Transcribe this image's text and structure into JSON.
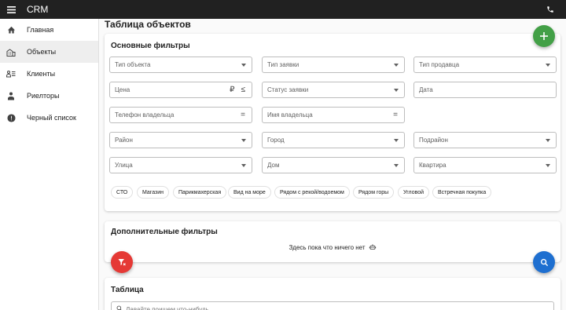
{
  "app": {
    "title": "CRM"
  },
  "sidebar": {
    "items": [
      {
        "label": "Главная",
        "icon": "home-icon"
      },
      {
        "label": "Объекты",
        "icon": "building-icon"
      },
      {
        "label": "Клиенты",
        "icon": "contacts-icon"
      },
      {
        "label": "Риелторы",
        "icon": "person-icon"
      },
      {
        "label": "Черный список",
        "icon": "alert-icon"
      }
    ],
    "active": "Объекты"
  },
  "page": {
    "title": "Таблица объектов"
  },
  "main_filters": {
    "title": "Основные фильтры",
    "fields": {
      "object_type": "Тип объекта",
      "request_type": "Тип заявки",
      "seller_type": "Тип продавца",
      "price": "Цена",
      "price_currency": "₽",
      "price_operator": "≤",
      "request_status": "Статус заявки",
      "date": "Дата",
      "owner_phone": "Телефон владельца",
      "owner_phone_operator": "=",
      "owner_name": "Имя владельца",
      "owner_name_operator": "=",
      "district": "Район",
      "city": "Город",
      "subdistrict": "Подрайон",
      "street": "Улица",
      "house": "Дом",
      "apartment": "Квартира"
    },
    "chips": [
      "СТО",
      "Магазин",
      "Парикмахерская",
      "Вид на море",
      "Рядом с рекой/водоемом",
      "Рядом горы",
      "Угловой",
      "Встречная покупка"
    ]
  },
  "extra_filters": {
    "title": "Дополнительные фильтры",
    "empty_text": "Здесь пока что ничего нет"
  },
  "table": {
    "title": "Таблица",
    "search_placeholder": "Давайте поищем что-нибудь"
  },
  "colors": {
    "topbar": "#212121",
    "add": "#43a047",
    "clear": "#e53935",
    "search": "#1e6fd0"
  }
}
